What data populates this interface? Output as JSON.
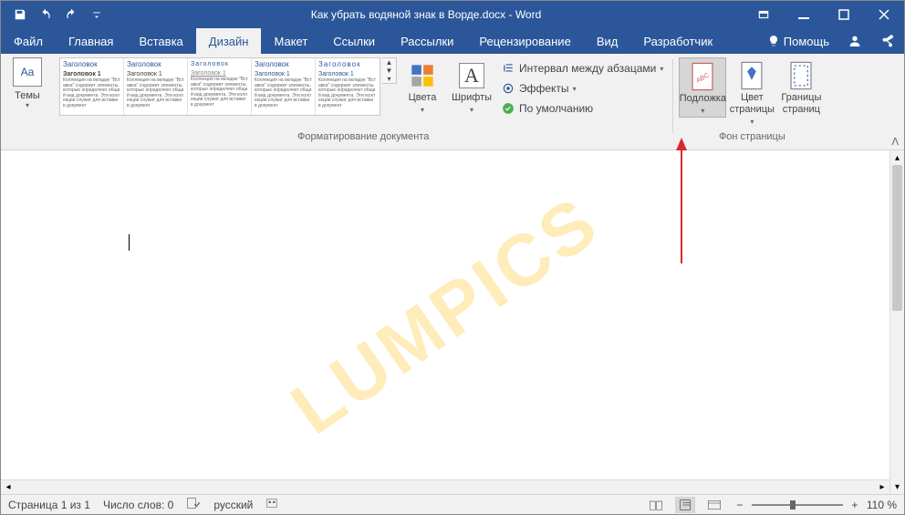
{
  "title": "Как убрать водяной знак в Ворде.docx - Word",
  "tabs": {
    "file": "Файл",
    "home": "Главная",
    "insert": "Вставка",
    "design": "Дизайн",
    "layout": "Макет",
    "references": "Ссылки",
    "mailings": "Рассылки",
    "review": "Рецензирование",
    "view": "Вид",
    "developer": "Разработчик",
    "help": "Помощь"
  },
  "ribbon": {
    "themes": "Темы",
    "doc_format_label": "Форматирование документа",
    "page_bg_label": "Фон страницы",
    "colors": "Цвета",
    "fonts": "Шрифты",
    "paragraph_spacing": "Интервал между абзацами",
    "effects": "Эффекты",
    "default": "По умолчанию",
    "watermark": "Подложка",
    "page_color": "Цвет страницы",
    "page_borders": "Границы страниц",
    "gallery": {
      "head": "Заголовок",
      "sub": "Заголовок 1",
      "body": "Коллекция на вкладке \"Вставка\" содержит элементы, которые определяют общий вид документа. Эти коллекции служат для вставки в документ"
    }
  },
  "watermark_text": "LUMPICS",
  "status": {
    "page": "Страница 1 из 1",
    "words": "Число слов: 0",
    "lang": "русский",
    "zoom": "110 %"
  }
}
